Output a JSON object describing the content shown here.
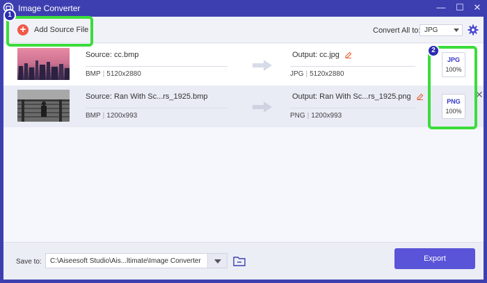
{
  "window": {
    "title": "Image Converter",
    "controls": {
      "minimize": "—",
      "maximize": "☐",
      "close": "✕"
    }
  },
  "toolbar": {
    "add_source_label": "Add Source File",
    "convert_all_label": "Convert All to:",
    "convert_all_value": "JPG"
  },
  "files": [
    {
      "source": "Source: cc.bmp",
      "source_format": "BMP",
      "source_size": "5120x2880",
      "output": "Output: cc.jpg",
      "output_format": "JPG",
      "output_size": "5120x2880",
      "format_badge": "JPG",
      "quality": "100%"
    },
    {
      "source": "Source: Ran With Sc...rs_1925.bmp",
      "source_format": "BMP",
      "source_size": "1200x993",
      "output": "Output: Ran With Sc...rs_1925.png",
      "output_format": "PNG",
      "output_size": "1200x993",
      "format_badge": "PNG",
      "quality": "100%"
    }
  ],
  "footer": {
    "save_to_label": "Save to:",
    "save_path": "C:\\Aiseesoft Studio\\Ais...ltimate\\Image Converter",
    "export_label": "Export"
  },
  "annotations": {
    "callout_1": "1",
    "callout_2": "2"
  },
  "colors": {
    "accent": "#5a54d8",
    "title_bar": "#3d3fb0",
    "callout": "#3bdc3b",
    "add_icon": "#f05a4a"
  }
}
